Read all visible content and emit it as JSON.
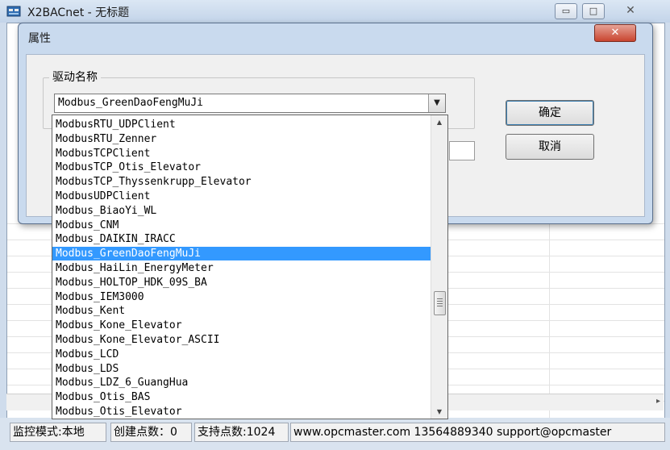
{
  "main_window": {
    "title": "X2BACnet - 无标题",
    "min_glyph": "▭",
    "max_glyph": "□",
    "close_glyph": "✕",
    "hscroll_right_glyph": "▸"
  },
  "dialog": {
    "title": "属性",
    "close_glyph": "✕",
    "group_label": "驱动名称",
    "combo_value": "Modbus_GreenDaoFengMuJi",
    "combo_arrow_glyph": "▼",
    "ok_label": "确定",
    "cancel_label": "取消"
  },
  "dropdown": {
    "items": [
      "ModbusRTU_UDPClient",
      "ModbusRTU_Zenner",
      "ModbusTCPClient",
      "ModbusTCP_Otis_Elevator",
      "ModbusTCP_Thyssenkrupp_Elevator",
      "ModbusUDPClient",
      "Modbus_BiaoYi_WL",
      "Modbus_CNM",
      "Modbus_DAIKIN_IRACC",
      "Modbus_GreenDaoFengMuJi",
      "Modbus_HaiLin_EnergyMeter",
      "Modbus_HOLTOP_HDK_09S_BA",
      "Modbus_IEM3000",
      "Modbus_Kent",
      "Modbus_Kone_Elevator",
      "Modbus_Kone_Elevator_ASCII",
      "Modbus_LCD",
      "Modbus_LDS",
      "Modbus_LDZ_6_GuangHua",
      "Modbus_Otis_BAS",
      "Modbus_Otis_Elevator"
    ],
    "selected_index": 9,
    "scroll_up_glyph": "▲",
    "scroll_down_glyph": "▼"
  },
  "statusbar": {
    "mode": "监控模式:本地",
    "created_points": "创建点数：0",
    "supported_points": "支持点数:1024",
    "contact": "www.opcmaster.com 13564889340 support@opcmaster"
  },
  "colors": {
    "selection": "#3399ff",
    "dialog_frame": "#c9daee",
    "close_button": "#c9452f"
  },
  "icons": {
    "app": "app-window-icon",
    "dialog_close": "close-icon",
    "combo_arrow": "chevron-down-icon"
  }
}
